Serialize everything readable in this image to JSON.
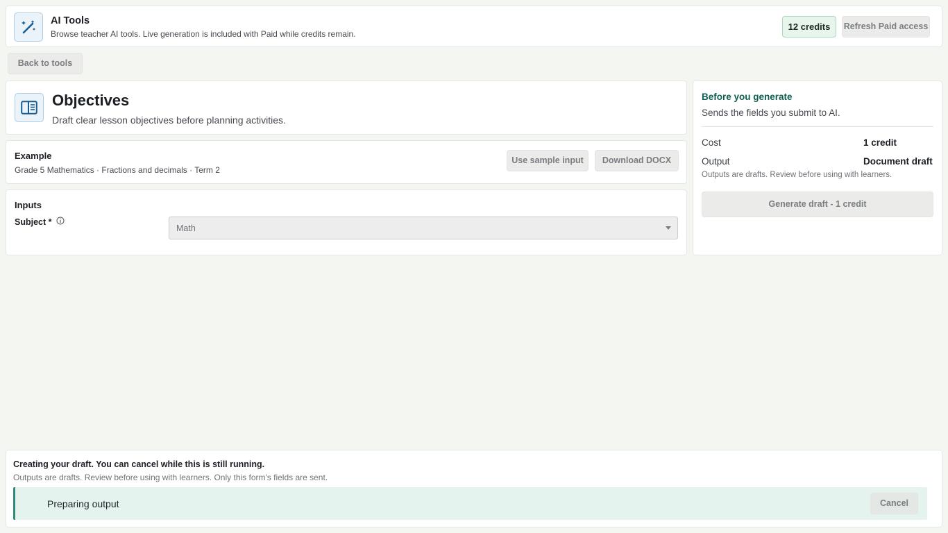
{
  "header": {
    "title": "AI Tools",
    "subtitle": "Browse teacher AI tools. Live generation is included with Paid while credits remain.",
    "credits": "12 credits",
    "refresh_label": "Refresh Paid access",
    "icon": "magic-wand-icon"
  },
  "nav": {
    "back_label": "Back to tools"
  },
  "tool": {
    "title": "Objectives",
    "description": "Draft clear lesson objectives before planning activities.",
    "icon": "book-icon"
  },
  "example": {
    "title": "Example",
    "description": "Grade 5 Mathematics · Fractions and decimals · Term 2",
    "sample_label": "Use sample input",
    "download_label": "Download DOCX"
  },
  "inputs": {
    "title": "Inputs",
    "subject_label": "Subject *",
    "subject_value": "Math"
  },
  "generate": {
    "title": "Before you generate",
    "description": "Sends the fields you submit to AI.",
    "cost_label": "Cost",
    "cost_value": "1 credit",
    "output_label": "Output",
    "output_value": "Document draft",
    "note": "Outputs are drafts. Review before using with learners.",
    "button_label": "Generate draft - 1 credit"
  },
  "status": {
    "title": "Creating your draft. You can cancel while this is still running.",
    "note": "Outputs are drafts. Review before using with learners. Only this form's fields are sent.",
    "progress_text": "Preparing output",
    "cancel_label": "Cancel"
  },
  "colors": {
    "accent": "#0f5e52",
    "progress_border": "#2e8b7b",
    "progress_bg": "#e5f3ef",
    "credits_bg": "#e8f5ec"
  }
}
